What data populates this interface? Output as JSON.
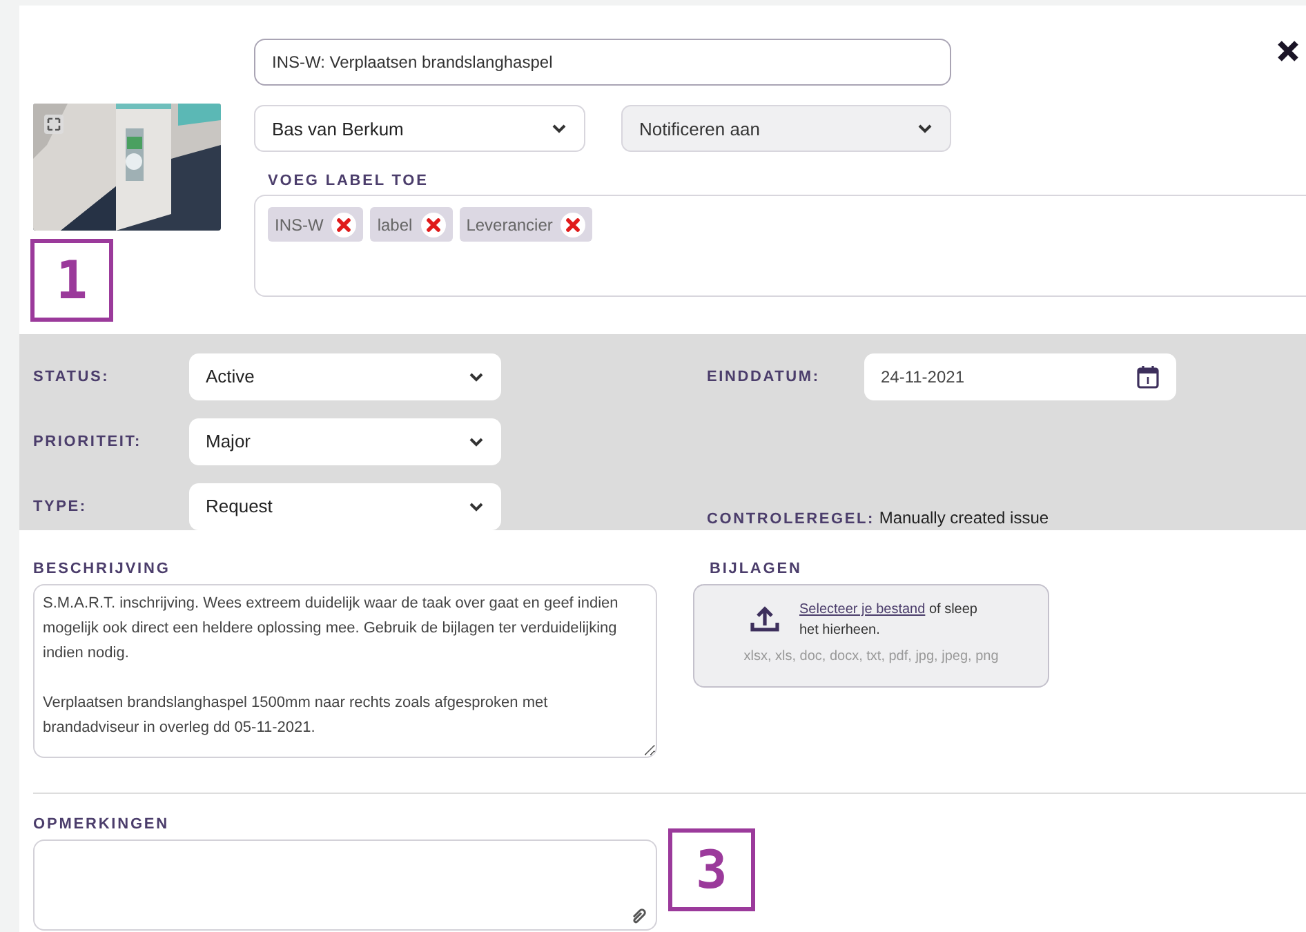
{
  "header": {
    "callout": "1",
    "title_field": {
      "value": "INS-W: Verplaatsen brandslanghaspel"
    },
    "assignee": {
      "value": "Bas van Berkum"
    },
    "notify": {
      "placeholder": "Notificeren aan"
    },
    "labels": {
      "heading": "VOEG LABEL TOE",
      "tags": [
        "INS-W",
        "label",
        "Leverancier"
      ]
    }
  },
  "details": {
    "fields": [
      {
        "kind": "select",
        "label": "STATUS:",
        "value": "Active"
      },
      {
        "kind": "date",
        "label": "EINDDATUM:",
        "value": "24-11-2021"
      },
      {
        "kind": "select",
        "label": "PRIORITEIT:",
        "value": "Major"
      },
      {
        "kind": "empty"
      },
      {
        "kind": "select",
        "label": "TYPE:",
        "value": "Request"
      },
      {
        "kind": "info",
        "label": "CONTROLEREGEL:",
        "value": "Manually created issue"
      }
    ]
  },
  "description": {
    "heading": "BESCHRIJVING",
    "value": "S.M.A.R.T. inschrijving. Wees extreem duidelijk waar de taak over gaat en geef indien mogelijk ook direct een heldere oplossing mee. Gebruik de bijlagen ter verduidelijking indien nodig.\n\nVerplaatsen brandslanghaspel 1500mm naar rechts zoals afgesproken met brandadviseur in overleg dd 05-11-2021."
  },
  "attachments": {
    "heading": "BIJLAGEN",
    "link": "Selecteer je bestand",
    "text": "of sleep het hierheen.",
    "formats": "xlsx, xls, doc, docx, txt, pdf, jpg, jpeg, png"
  },
  "comments": {
    "heading": "OPMERKINGEN",
    "callout": "3"
  }
}
